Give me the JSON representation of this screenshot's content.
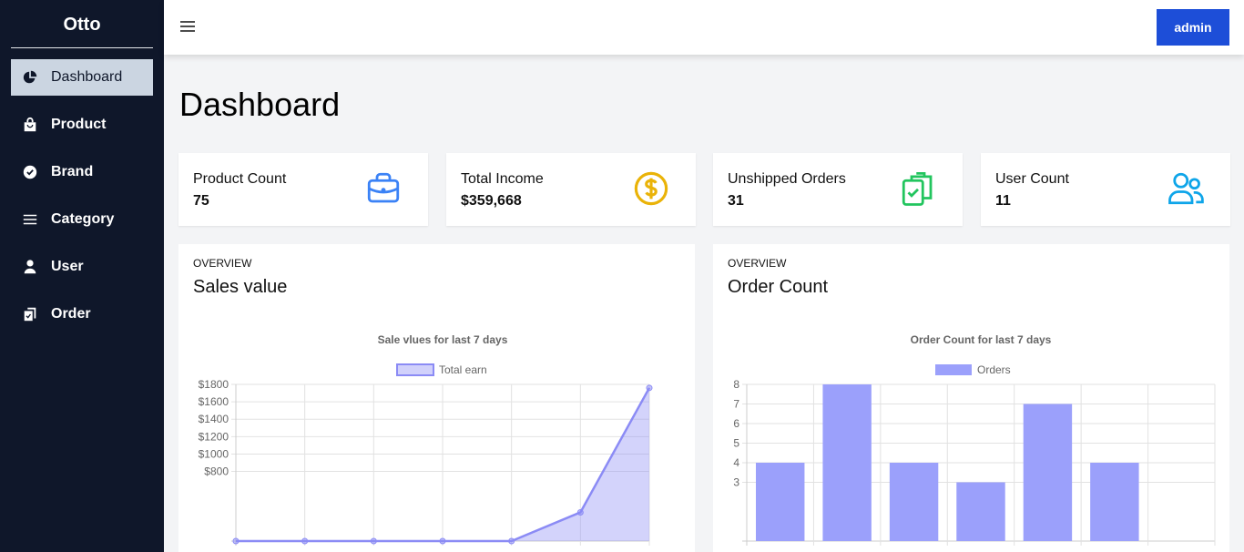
{
  "app": {
    "name": "Otto"
  },
  "sidebar": {
    "items": [
      {
        "label": "Dashboard",
        "icon": "pie-chart-icon"
      },
      {
        "label": "Product",
        "icon": "shopping-bag-icon"
      },
      {
        "label": "Brand",
        "icon": "check-badge-icon"
      },
      {
        "label": "Category",
        "icon": "list-icon"
      },
      {
        "label": "User",
        "icon": "user-icon"
      },
      {
        "label": "Order",
        "icon": "clipboard-check-icon"
      }
    ]
  },
  "header": {
    "user_button": "admin"
  },
  "page": {
    "title": "Dashboard"
  },
  "stats": [
    {
      "label": "Product Count",
      "value": "75",
      "icon": "briefcase-icon",
      "color": "#3b82f6"
    },
    {
      "label": "Total Income",
      "value": "$359,668",
      "icon": "dollar-icon",
      "color": "#eab308"
    },
    {
      "label": "Unshipped Orders",
      "value": "31",
      "icon": "clipboard-check-icon",
      "color": "#22c55e"
    },
    {
      "label": "User Count",
      "value": "11",
      "icon": "users-icon",
      "color": "#0ea5e9"
    }
  ],
  "panels": [
    {
      "overline": "OVERVIEW",
      "title": "Sales value"
    },
    {
      "overline": "OVERVIEW",
      "title": "Order Count"
    }
  ],
  "chart_data": [
    {
      "type": "area",
      "title": "Sale vlues for last 7 days",
      "legend": "Total earn",
      "series": [
        {
          "name": "Total earn",
          "values": [
            0,
            0,
            0,
            0,
            0,
            330,
            1760
          ]
        }
      ],
      "yticks": [
        "$1800",
        "$1600",
        "$1400",
        "$1200",
        "$1000",
        "$800"
      ],
      "ylim": [
        0,
        1800
      ],
      "color": "#8b8bf5"
    },
    {
      "type": "bar",
      "title": "Order Count for last 7 days",
      "legend": "Orders",
      "series": [
        {
          "name": "Orders",
          "values": [
            4,
            8,
            4,
            3,
            7,
            4,
            0
          ]
        }
      ],
      "yticks": [
        "8",
        "7",
        "6",
        "5",
        "4",
        "3"
      ],
      "ylim": [
        0,
        8
      ],
      "color": "#9ba0fb"
    }
  ]
}
